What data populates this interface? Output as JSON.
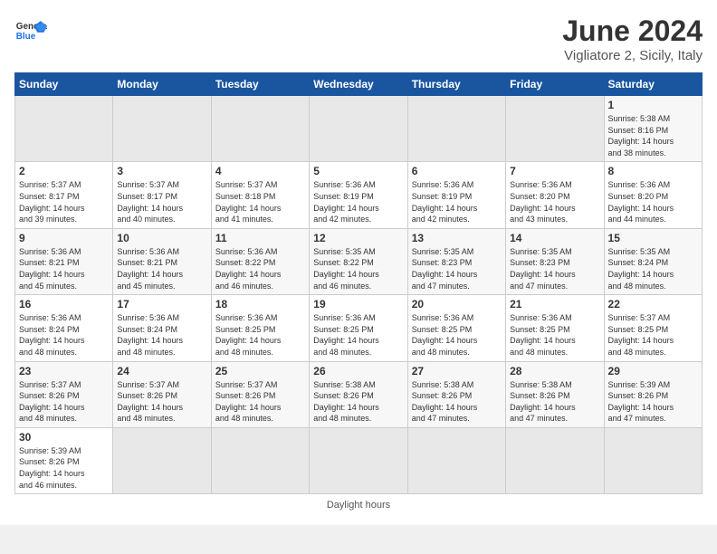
{
  "logo": {
    "text_general": "General",
    "text_blue": "Blue"
  },
  "header": {
    "month_title": "June 2024",
    "subtitle": "Vigliatore 2, Sicily, Italy"
  },
  "days_of_week": [
    "Sunday",
    "Monday",
    "Tuesday",
    "Wednesday",
    "Thursday",
    "Friday",
    "Saturday"
  ],
  "weeks": [
    [
      {
        "day": "",
        "info": ""
      },
      {
        "day": "",
        "info": ""
      },
      {
        "day": "",
        "info": ""
      },
      {
        "day": "",
        "info": ""
      },
      {
        "day": "",
        "info": ""
      },
      {
        "day": "",
        "info": ""
      },
      {
        "day": "1",
        "info": "Sunrise: 5:38 AM\nSunset: 8:16 PM\nDaylight: 14 hours\nand 38 minutes."
      }
    ],
    [
      {
        "day": "2",
        "info": "Sunrise: 5:37 AM\nSunset: 8:17 PM\nDaylight: 14 hours\nand 39 minutes."
      },
      {
        "day": "3",
        "info": "Sunrise: 5:37 AM\nSunset: 8:17 PM\nDaylight: 14 hours\nand 40 minutes."
      },
      {
        "day": "4",
        "info": "Sunrise: 5:37 AM\nSunset: 8:18 PM\nDaylight: 14 hours\nand 41 minutes."
      },
      {
        "day": "5",
        "info": "Sunrise: 5:36 AM\nSunset: 8:19 PM\nDaylight: 14 hours\nand 42 minutes."
      },
      {
        "day": "6",
        "info": "Sunrise: 5:36 AM\nSunset: 8:19 PM\nDaylight: 14 hours\nand 42 minutes."
      },
      {
        "day": "7",
        "info": "Sunrise: 5:36 AM\nSunset: 8:20 PM\nDaylight: 14 hours\nand 43 minutes."
      },
      {
        "day": "8",
        "info": "Sunrise: 5:36 AM\nSunset: 8:20 PM\nDaylight: 14 hours\nand 44 minutes."
      }
    ],
    [
      {
        "day": "9",
        "info": "Sunrise: 5:36 AM\nSunset: 8:21 PM\nDaylight: 14 hours\nand 45 minutes."
      },
      {
        "day": "10",
        "info": "Sunrise: 5:36 AM\nSunset: 8:21 PM\nDaylight: 14 hours\nand 45 minutes."
      },
      {
        "day": "11",
        "info": "Sunrise: 5:36 AM\nSunset: 8:22 PM\nDaylight: 14 hours\nand 46 minutes."
      },
      {
        "day": "12",
        "info": "Sunrise: 5:35 AM\nSunset: 8:22 PM\nDaylight: 14 hours\nand 46 minutes."
      },
      {
        "day": "13",
        "info": "Sunrise: 5:35 AM\nSunset: 8:23 PM\nDaylight: 14 hours\nand 47 minutes."
      },
      {
        "day": "14",
        "info": "Sunrise: 5:35 AM\nSunset: 8:23 PM\nDaylight: 14 hours\nand 47 minutes."
      },
      {
        "day": "15",
        "info": "Sunrise: 5:35 AM\nSunset: 8:24 PM\nDaylight: 14 hours\nand 48 minutes."
      }
    ],
    [
      {
        "day": "16",
        "info": "Sunrise: 5:36 AM\nSunset: 8:24 PM\nDaylight: 14 hours\nand 48 minutes."
      },
      {
        "day": "17",
        "info": "Sunrise: 5:36 AM\nSunset: 8:24 PM\nDaylight: 14 hours\nand 48 minutes."
      },
      {
        "day": "18",
        "info": "Sunrise: 5:36 AM\nSunset: 8:25 PM\nDaylight: 14 hours\nand 48 minutes."
      },
      {
        "day": "19",
        "info": "Sunrise: 5:36 AM\nSunset: 8:25 PM\nDaylight: 14 hours\nand 48 minutes."
      },
      {
        "day": "20",
        "info": "Sunrise: 5:36 AM\nSunset: 8:25 PM\nDaylight: 14 hours\nand 48 minutes."
      },
      {
        "day": "21",
        "info": "Sunrise: 5:36 AM\nSunset: 8:25 PM\nDaylight: 14 hours\nand 48 minutes."
      },
      {
        "day": "22",
        "info": "Sunrise: 5:37 AM\nSunset: 8:25 PM\nDaylight: 14 hours\nand 48 minutes."
      }
    ],
    [
      {
        "day": "23",
        "info": "Sunrise: 5:37 AM\nSunset: 8:26 PM\nDaylight: 14 hours\nand 48 minutes."
      },
      {
        "day": "24",
        "info": "Sunrise: 5:37 AM\nSunset: 8:26 PM\nDaylight: 14 hours\nand 48 minutes."
      },
      {
        "day": "25",
        "info": "Sunrise: 5:37 AM\nSunset: 8:26 PM\nDaylight: 14 hours\nand 48 minutes."
      },
      {
        "day": "26",
        "info": "Sunrise: 5:38 AM\nSunset: 8:26 PM\nDaylight: 14 hours\nand 48 minutes."
      },
      {
        "day": "27",
        "info": "Sunrise: 5:38 AM\nSunset: 8:26 PM\nDaylight: 14 hours\nand 47 minutes."
      },
      {
        "day": "28",
        "info": "Sunrise: 5:38 AM\nSunset: 8:26 PM\nDaylight: 14 hours\nand 47 minutes."
      },
      {
        "day": "29",
        "info": "Sunrise: 5:39 AM\nSunset: 8:26 PM\nDaylight: 14 hours\nand 47 minutes."
      }
    ],
    [
      {
        "day": "30",
        "info": "Sunrise: 5:39 AM\nSunset: 8:26 PM\nDaylight: 14 hours\nand 46 minutes."
      },
      {
        "day": "",
        "info": ""
      },
      {
        "day": "",
        "info": ""
      },
      {
        "day": "",
        "info": ""
      },
      {
        "day": "",
        "info": ""
      },
      {
        "day": "",
        "info": ""
      },
      {
        "day": "",
        "info": ""
      }
    ]
  ],
  "footer": {
    "note": "Daylight hours"
  }
}
